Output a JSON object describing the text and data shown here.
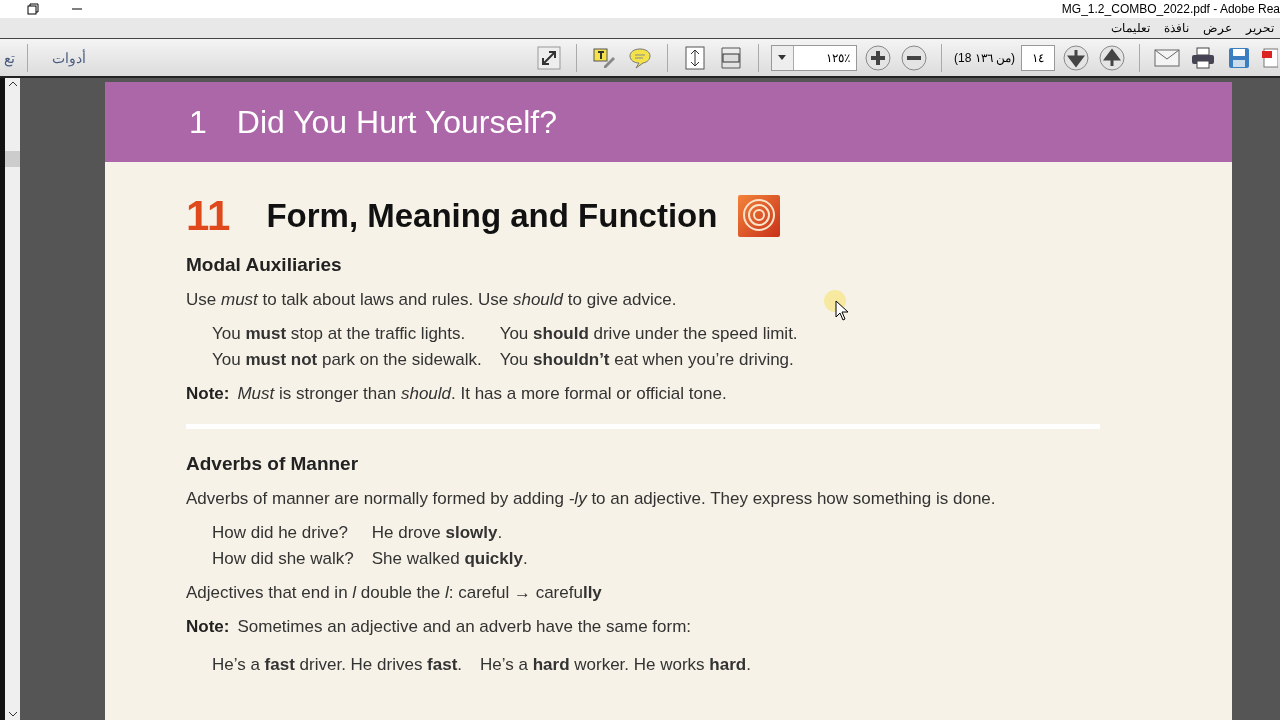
{
  "window": {
    "title": "MG_1.2_COMBO_2022.pdf - Adobe Rea"
  },
  "menu": [
    "تحرير",
    "عرض",
    "نافذة",
    "تعليمات"
  ],
  "toolbar": {
    "tools_cut": "تع",
    "tools": "أدوات",
    "zoom": "١٢٥٪",
    "page_count": "(18 من ١٣٦)",
    "page": "١٤"
  },
  "document": {
    "unit_number": "1",
    "unit_title": "Did You Hurt Yourself?",
    "section_number": "11",
    "section_title": "Form, Meaning and Function",
    "blocks": [
      {
        "kind": "heading",
        "text": "Modal Auxiliaries"
      },
      {
        "kind": "para",
        "text": "Use *must* to talk about laws and rules. Use *should* to give advice."
      },
      {
        "kind": "examples",
        "rows": [
          [
            "You **must** stop at the traffic lights.",
            "You **should** drive under the speed limit."
          ],
          [
            "You **must not** park on the sidewalk.",
            "You **shouldn’t** eat when you’re driving."
          ]
        ]
      },
      {
        "kind": "note",
        "label": "Note:",
        "text": "*Must* is stronger than *should*. It has a more formal or official tone."
      },
      {
        "kind": "rule"
      },
      {
        "kind": "heading",
        "text": "Adverbs of Manner"
      },
      {
        "kind": "para",
        "text": "Adverbs of manner are normally formed by adding *-ly* to an adjective. They express how something is done."
      },
      {
        "kind": "examples",
        "rows": [
          [
            "How did he drive?",
            "He drove **slowly**."
          ],
          [
            "How did she walk?",
            "She walked **quickly**."
          ]
        ]
      },
      {
        "kind": "para",
        "text": "Adjectives that end in *l* double the *l*: careful → carefu**lly**"
      },
      {
        "kind": "note",
        "label": "Note:",
        "text": "Sometimes an adjective and an adverb have the same form:"
      },
      {
        "kind": "examples",
        "rows": [
          [
            "He’s a **fast** driver. He drives **fast**.",
            "He’s a **hard** worker. He works **hard**."
          ]
        ]
      }
    ]
  }
}
